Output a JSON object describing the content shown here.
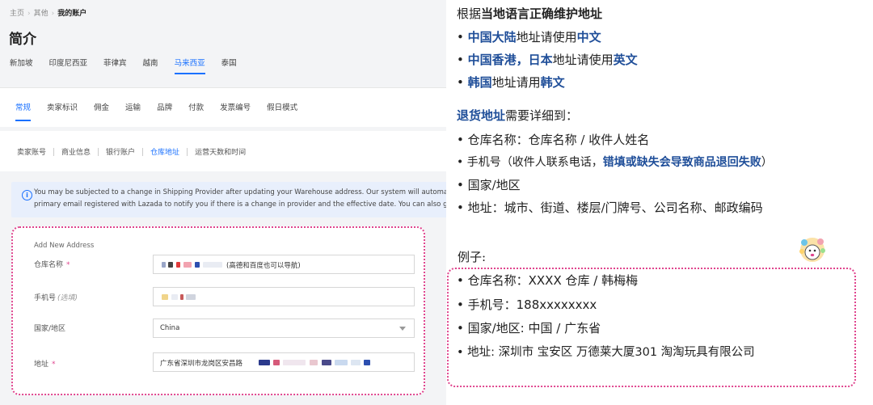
{
  "breadcrumb": [
    "主页",
    "其他",
    "我的账户"
  ],
  "page_title": "简介",
  "countries": {
    "items": [
      "新加坡",
      "印度尼西亚",
      "菲律宾",
      "越南",
      "马来西亚",
      "泰国"
    ],
    "active": "马来西亚"
  },
  "settings_tabs": {
    "items": [
      "常规",
      "卖家标识",
      "佣金",
      "运输",
      "品牌",
      "付款",
      "发票编号",
      "假日模式"
    ],
    "active": "常规"
  },
  "sub_tabs": {
    "items": [
      "卖家账号",
      "商业信息",
      "银行账户",
      "仓库地址",
      "运营天数和时间"
    ],
    "active": "仓库地址"
  },
  "notice": {
    "line1": "You may be subjected to a change in Shipping Provider after updating your Warehouse address. Our system will automatica",
    "line2": "primary email registered with Lazada to notify you if there is a change in provider and the effective date. You can also go to"
  },
  "form": {
    "heading": "Add New Address",
    "warehouse_label": "仓库名称",
    "warehouse_hint": "(高德和百度也可以导航)",
    "phone_label": "手机号",
    "phone_optional": "(选填)",
    "country_label": "国家/地区",
    "country_value": "China",
    "address_label": "地址",
    "address_value": "广东省深圳市龙岗区安昌路",
    "required_mark": "*"
  },
  "guide": {
    "rule_title_pre": "根据",
    "rule_title_bold": "当地语言正确维护地址",
    "rule1_a": "• ",
    "rule1_b": "中国大陆",
    "rule1_c": "地址请使用",
    "rule1_d": "中文",
    "rule2_a": "• ",
    "rule2_b": "中国香港，日本",
    "rule2_c": "地址请使用",
    "rule2_d": "英文",
    "rule3_a": "• ",
    "rule3_b": "韩国",
    "rule3_c": "地址请用",
    "rule3_d": "韩文",
    "return_bold": "退货地址",
    "return_rest": "需要详细到：",
    "item1": "• 仓库名称：仓库名称 / 收件人姓名",
    "item2_a": "• 手机号（收件人联系电话，",
    "item2_b": "错填或缺失会导致商品退回失败",
    "item2_c": "）",
    "item3": "• 国家/地区",
    "item4": "• 地址：城市、街道、楼层/门牌号、公司名称、邮政编码",
    "example_title": "例子:",
    "ex1": "• 仓库名称：XXXX 仓库 / 韩梅梅",
    "ex2": "• 手机号：188xxxxxxxx",
    "ex3": "• 国家/地区: 中国 / 广东省",
    "ex4": "• 地址: 深圳市 宝安区 万德莱大厦301 淘淘玩具有限公司"
  },
  "colors": {
    "accent": "#1a71ff",
    "highlight_border": "#e0458e",
    "notice_bg": "#e8effc"
  }
}
